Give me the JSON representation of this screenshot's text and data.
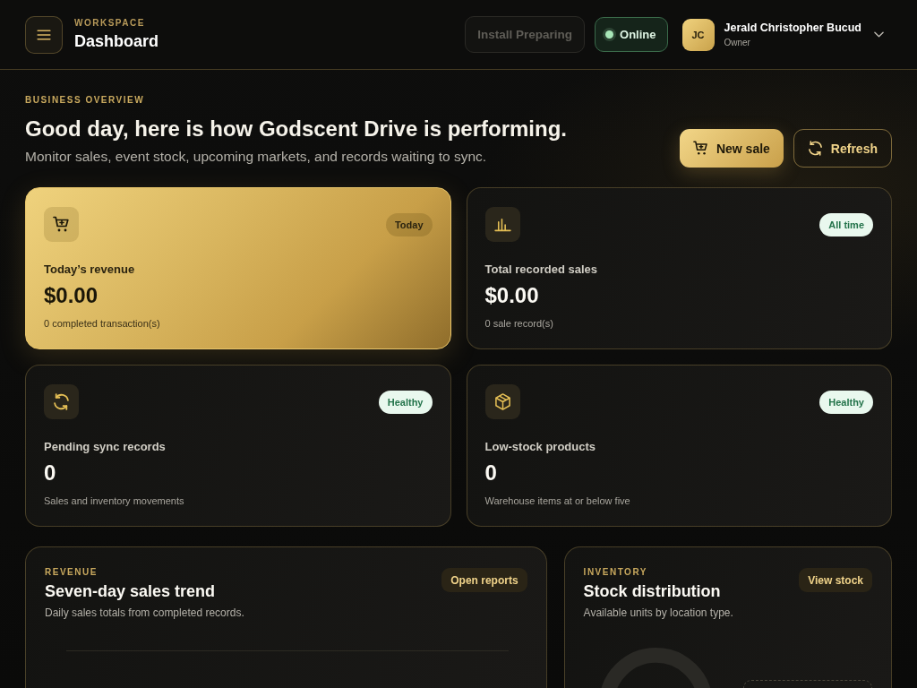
{
  "header": {
    "eyebrow": "WORKSPACE",
    "title": "Dashboard",
    "install_button": {
      "label": "Install Preparing",
      "disabled": true
    },
    "status": {
      "label": "Online",
      "online": true
    },
    "user": {
      "initials": "JC",
      "name": "Jerald Christopher Bucud",
      "role": "Owner"
    }
  },
  "overview": {
    "eyebrow": "BUSINESS OVERVIEW",
    "heading": "Good day, here is how Godscent Drive is performing.",
    "subtitle": "Monitor sales, event stock, upcoming markets, and records waiting to sync.",
    "actions": [
      {
        "label": "New sale",
        "kind": "primary"
      },
      {
        "label": "Refresh",
        "kind": "secondary"
      }
    ]
  },
  "stats": [
    {
      "kind": "revenue",
      "label": "Today’s revenue",
      "value": "$0.00",
      "note": "0 completed transaction(s)",
      "badge": "Today",
      "highlighted": true
    },
    {
      "kind": "sales",
      "label": "Total recorded sales",
      "value": "$0.00",
      "note": "0 sale record(s)",
      "badge": "All time",
      "highlighted": false
    },
    {
      "kind": "sync",
      "label": "Pending sync records",
      "value": "0",
      "note": "Sales and inventory movements",
      "badge": "Healthy",
      "highlighted": false
    },
    {
      "kind": "inventory",
      "label": "Low-stock products",
      "value": "0",
      "note": "Warehouse items at or below five",
      "badge": "Healthy",
      "highlighted": false
    }
  ],
  "panels": [
    {
      "kind": "trend",
      "eyebrow": "REVENUE",
      "title": "Seven-day sales trend",
      "subtitle": "Daily sales totals from completed records.",
      "action": "Open reports"
    },
    {
      "kind": "distribution",
      "eyebrow": "INVENTORY",
      "title": "Stock distribution",
      "subtitle": "Available units by location type.",
      "action": "View stock"
    }
  ]
}
